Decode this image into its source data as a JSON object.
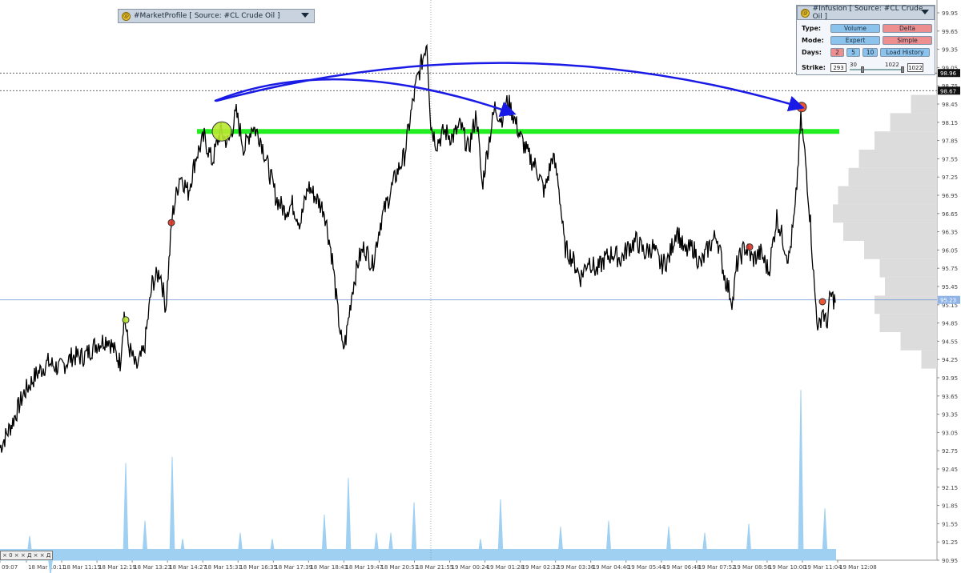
{
  "market_profile": {
    "title": "#MarketProfile [ Source: #CL Crude Oil ]"
  },
  "infusion": {
    "title": "#Infusion [ Source: #CL Crude Oil ]",
    "type_label": "Type:",
    "type_options": [
      "Volume",
      "Delta"
    ],
    "mode_label": "Mode:",
    "mode_options": [
      "Expert",
      "Simple"
    ],
    "days_label": "Days:",
    "days_options": [
      "2",
      "5",
      "10"
    ],
    "load_history": "Load History",
    "strike_label": "Strike:",
    "strike_min": "293",
    "strike_low": "30",
    "strike_high": "1022",
    "strike_max": "1022"
  },
  "mini_indicator": "× 0 × × Д × × Д",
  "colors": {
    "candles": "#000000",
    "volume": "#9fd0f2",
    "profile": "#dcdcdc",
    "green_level": "#22ee22",
    "arrows": "#1a1ae6",
    "crosshair": "#6a8fd6"
  },
  "chart_data": {
    "type": "line",
    "title": "",
    "ylim": [
      90.95,
      99.95
    ],
    "y_ticks": [
      "99.95",
      "99.65",
      "99.35",
      "99.05",
      "98.75",
      "98.45",
      "98.15",
      "97.85",
      "97.55",
      "97.25",
      "96.95",
      "96.65",
      "96.35",
      "96.05",
      "95.75",
      "95.45",
      "95.15",
      "94.85",
      "94.55",
      "94.25",
      "93.95",
      "93.65",
      "93.35",
      "93.05",
      "92.75",
      "92.45",
      "92.15",
      "91.85",
      "91.55",
      "91.25",
      "90.95"
    ],
    "x_labels": [
      "09:07",
      "18 Mar 10:11",
      "18 Mar 11:15",
      "18 Mar 12:19",
      "18 Mar 13:23",
      "18 Mar 14:27",
      "18 Mar 15:31",
      "18 Mar 16:35",
      "18 Mar 17:39",
      "18 Mar 18:43",
      "18 Mar 19:47",
      "18 Mar 20:51",
      "18 Mar 21:55",
      "19 Mar 00:24",
      "19 Mar 01:28",
      "19 Mar 02:32",
      "19 Mar 03:36",
      "19 Mar 04:40",
      "19 Mar 05:44",
      "19 Mar 06:48",
      "19 Mar 07:52",
      "19 Mar 08:56",
      "19 Mar 10:00",
      "19 Mar 11:04",
      "19 Mar 12:08"
    ],
    "price_labels": [
      {
        "value": 98.96,
        "text": "98.96"
      },
      {
        "value": 98.67,
        "text": "98.67"
      },
      {
        "value": 95.23,
        "text": "95.23"
      }
    ],
    "green_level": 98.0,
    "price_path": [
      [
        0,
        92.8
      ],
      [
        15,
        93.2
      ],
      [
        30,
        93.7
      ],
      [
        45,
        94.0
      ],
      [
        60,
        94.2
      ],
      [
        75,
        94.1
      ],
      [
        90,
        94.3
      ],
      [
        105,
        94.3
      ],
      [
        120,
        94.5
      ],
      [
        135,
        94.6
      ],
      [
        150,
        94.2
      ],
      [
        155,
        95.0
      ],
      [
        160,
        94.5
      ],
      [
        170,
        94.1
      ],
      [
        180,
        94.4
      ],
      [
        190,
        95.5
      ],
      [
        200,
        95.7
      ],
      [
        207,
        95.1
      ],
      [
        215,
        96.6
      ],
      [
        225,
        97.3
      ],
      [
        235,
        97.0
      ],
      [
        245,
        97.6
      ],
      [
        255,
        97.9
      ],
      [
        265,
        97.5
      ],
      [
        275,
        98.0
      ],
      [
        285,
        97.8
      ],
      [
        295,
        98.3
      ],
      [
        305,
        97.7
      ],
      [
        315,
        98.1
      ],
      [
        325,
        97.9
      ],
      [
        335,
        97.4
      ],
      [
        345,
        96.9
      ],
      [
        355,
        96.7
      ],
      [
        365,
        96.8
      ],
      [
        375,
        96.5
      ],
      [
        385,
        97.1
      ],
      [
        395,
        96.9
      ],
      [
        405,
        96.7
      ],
      [
        415,
        95.9
      ],
      [
        422,
        95.0
      ],
      [
        428,
        94.4
      ],
      [
        432,
        94.6
      ],
      [
        440,
        95.4
      ],
      [
        448,
        95.9
      ],
      [
        455,
        96.1
      ],
      [
        465,
        95.8
      ],
      [
        475,
        96.5
      ],
      [
        485,
        96.9
      ],
      [
        495,
        97.3
      ],
      [
        505,
        97.6
      ],
      [
        512,
        98.2
      ],
      [
        520,
        98.8
      ],
      [
        528,
        99.2
      ],
      [
        533,
        99.5
      ],
      [
        538,
        98.1
      ],
      [
        545,
        97.8
      ],
      [
        555,
        98.0
      ],
      [
        565,
        97.9
      ],
      [
        575,
        98.1
      ],
      [
        585,
        97.7
      ],
      [
        595,
        98.3
      ],
      [
        602,
        97.1
      ],
      [
        610,
        97.8
      ],
      [
        618,
        98.4
      ],
      [
        626,
        98.2
      ],
      [
        634,
        98.5
      ],
      [
        640,
        98.3
      ],
      [
        650,
        97.9
      ],
      [
        660,
        97.6
      ],
      [
        670,
        97.4
      ],
      [
        680,
        97.0
      ],
      [
        690,
        97.6
      ],
      [
        697,
        97.2
      ],
      [
        705,
        96.1
      ],
      [
        715,
        95.9
      ],
      [
        725,
        95.6
      ],
      [
        735,
        95.9
      ],
      [
        745,
        95.7
      ],
      [
        755,
        95.9
      ],
      [
        765,
        96.0
      ],
      [
        775,
        95.9
      ],
      [
        785,
        96.1
      ],
      [
        795,
        96.2
      ],
      [
        805,
        96.0
      ],
      [
        815,
        96.1
      ],
      [
        825,
        95.8
      ],
      [
        835,
        95.9
      ],
      [
        845,
        96.4
      ],
      [
        855,
        96.0
      ],
      [
        865,
        96.1
      ],
      [
        875,
        95.8
      ],
      [
        885,
        96.1
      ],
      [
        895,
        96.3
      ],
      [
        905,
        95.6
      ],
      [
        915,
        95.2
      ],
      [
        920,
        95.8
      ],
      [
        930,
        96.1
      ],
      [
        940,
        95.9
      ],
      [
        950,
        96.0
      ],
      [
        960,
        95.7
      ],
      [
        970,
        96.6
      ],
      [
        978,
        96.2
      ],
      [
        985,
        95.9
      ],
      [
        993,
        96.7
      ],
      [
        1000,
        98.2
      ],
      [
        1006,
        97.5
      ],
      [
        1012,
        96.5
      ],
      [
        1017,
        95.4
      ],
      [
        1022,
        94.7
      ],
      [
        1027,
        95.1
      ],
      [
        1032,
        94.8
      ],
      [
        1037,
        95.3
      ],
      [
        1044,
        95.2
      ]
    ],
    "volume_peaks": [
      [
        37,
        91.35
      ],
      [
        63,
        90.7
      ],
      [
        157,
        92.55
      ],
      [
        181,
        91.6
      ],
      [
        215,
        92.65
      ],
      [
        228,
        91.3
      ],
      [
        300,
        91.4
      ],
      [
        340,
        91.3
      ],
      [
        405,
        91.7
      ],
      [
        435,
        92.3
      ],
      [
        470,
        91.4
      ],
      [
        488,
        91.4
      ],
      [
        517,
        91.9
      ],
      [
        600,
        91.3
      ],
      [
        625,
        91.95
      ],
      [
        700,
        91.5
      ],
      [
        760,
        91.6
      ],
      [
        835,
        91.5
      ],
      [
        880,
        91.4
      ],
      [
        935,
        91.55
      ],
      [
        1000,
        93.75
      ],
      [
        1030,
        91.8
      ]
    ],
    "profile_levels": [
      [
        98.45,
        0.25
      ],
      [
        98.15,
        0.45
      ],
      [
        97.85,
        0.6
      ],
      [
        97.55,
        0.75
      ],
      [
        97.25,
        0.85
      ],
      [
        96.95,
        0.95
      ],
      [
        96.65,
        1.0
      ],
      [
        96.35,
        0.9
      ],
      [
        96.05,
        0.7
      ],
      [
        95.75,
        0.55
      ],
      [
        95.45,
        0.5
      ],
      [
        95.15,
        0.6
      ],
      [
        94.85,
        0.55
      ],
      [
        94.55,
        0.35
      ],
      [
        94.25,
        0.15
      ]
    ],
    "markers": [
      {
        "x": 277,
        "y": 98.0,
        "color": "#b8e830",
        "size": "large"
      },
      {
        "x": 157,
        "y": 94.9,
        "color": "#b8e830",
        "size": "small"
      },
      {
        "x": 214,
        "y": 96.5,
        "color": "#dd3322",
        "size": "small"
      },
      {
        "x": 1001,
        "y": 98.4,
        "color": "#e8441f",
        "size": "medium"
      },
      {
        "x": 936,
        "y": 96.1,
        "color": "#dd3322",
        "size": "small"
      },
      {
        "x": 1027,
        "y": 95.2,
        "color": "#e8441f",
        "size": "small"
      }
    ],
    "annotations": [
      {
        "type": "arrow",
        "from": [
          268,
          98.5
        ],
        "ctrl": [
          420,
          99.3
        ],
        "to": [
          640,
          98.3
        ]
      },
      {
        "type": "arrow",
        "from": [
          270,
          98.5
        ],
        "ctrl": [
          640,
          99.8
        ],
        "to": [
          1000,
          98.4
        ]
      }
    ],
    "crosshair_x": 538
  }
}
